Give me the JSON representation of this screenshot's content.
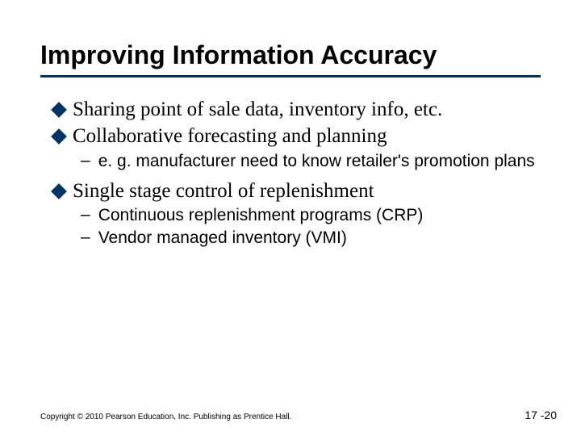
{
  "title": "Improving Information Accuracy",
  "bullets": {
    "b1": "Sharing point of sale data, inventory info, etc.",
    "b2": "Collaborative forecasting and planning",
    "b2_1": "e. g. manufacturer need to know retailer's promotion plans",
    "b3": "Single stage control of replenishment",
    "b3_1": "Continuous replenishment programs (CRP)",
    "b3_2": "Vendor managed inventory (VMI)"
  },
  "footer": {
    "copyright": "Copyright © 2010 Pearson Education, Inc. Publishing as Prentice Hall.",
    "pagenum": "17 -20"
  }
}
